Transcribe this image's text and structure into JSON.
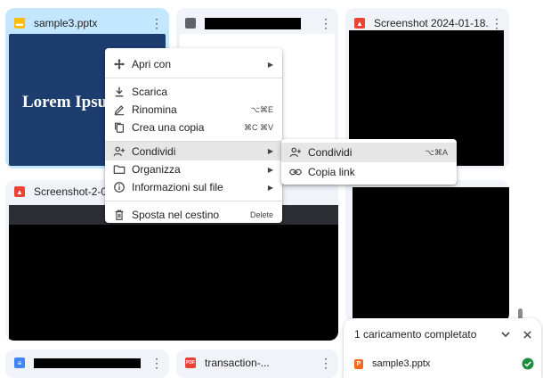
{
  "files": [
    {
      "name": "sample3.pptx",
      "type_icon": "slides-icon"
    },
    {
      "name": "",
      "type_icon": "file-icon"
    },
    {
      "name": "Screenshot 2024-01-18...",
      "type_icon": "image-icon"
    },
    {
      "name": "Screenshot-2-08-06",
      "type_icon": "image-icon"
    },
    {
      "name": "",
      "type_icon": "docs-icon"
    },
    {
      "name": "transaction-...",
      "type_icon": "pdf-icon"
    }
  ],
  "preview_text": "Lorem Ipsum",
  "pdf_badge": "PDF",
  "kebab_glyph": "⋮",
  "context_menu": {
    "items": [
      {
        "label": "Apri con",
        "icon": "move-icon",
        "shortcut": "",
        "submenu": true
      },
      {
        "label": "Scarica",
        "icon": "download-icon",
        "shortcut": "",
        "submenu": false
      },
      {
        "label": "Rinomina",
        "icon": "pencil-icon",
        "shortcut": "⌥⌘E",
        "submenu": false
      },
      {
        "label": "Crea una copia",
        "icon": "copy-icon",
        "shortcut": "⌘C ⌘V",
        "submenu": false
      },
      {
        "label": "Condividi",
        "icon": "person-add-icon",
        "shortcut": "",
        "submenu": true
      },
      {
        "label": "Organizza",
        "icon": "folder-icon",
        "shortcut": "",
        "submenu": true
      },
      {
        "label": "Informazioni sul file",
        "icon": "info-icon",
        "shortcut": "",
        "submenu": true
      },
      {
        "label": "Sposta nel cestino",
        "icon": "trash-icon",
        "shortcut": "Delete",
        "submenu": false
      }
    ]
  },
  "share_submenu": {
    "items": [
      {
        "label": "Condividi",
        "icon": "person-add-icon",
        "shortcut": "⌥⌘A"
      },
      {
        "label": "Copia link",
        "icon": "link-icon",
        "shortcut": ""
      }
    ]
  },
  "upload_toast": {
    "title": "1 caricamento completato",
    "file": "sample3.pptx",
    "status": "completed"
  },
  "colors": {
    "selected_card": "#c2e7ff",
    "card": "#f0f4f9",
    "slide_bg": "#1c3d6e",
    "success": "#1e8e3e"
  }
}
